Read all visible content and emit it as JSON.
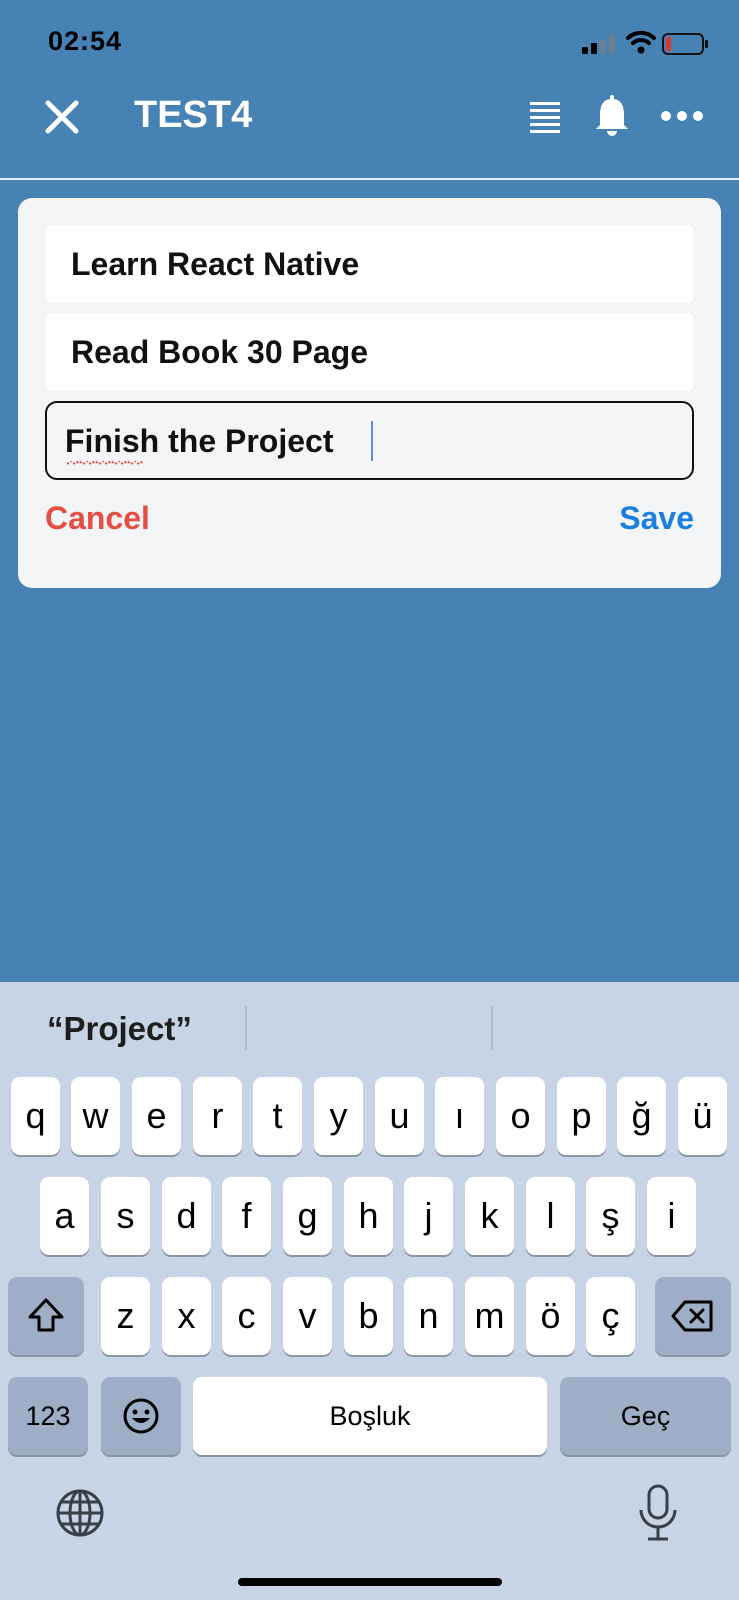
{
  "status_bar": {
    "time": "02:54"
  },
  "header": {
    "title": "TEST4"
  },
  "card": {
    "items": [
      "Learn React Native",
      "Read Book 30 Page"
    ],
    "edit_value": "Finish the Project",
    "cancel_label": "Cancel",
    "save_label": "Save"
  },
  "keyboard": {
    "suggestion": "“Project”",
    "row1": [
      "q",
      "w",
      "e",
      "r",
      "t",
      "y",
      "u",
      "ı",
      "o",
      "p",
      "ğ",
      "ü"
    ],
    "row2": [
      "a",
      "s",
      "d",
      "f",
      "g",
      "h",
      "j",
      "k",
      "l",
      "ş",
      "i"
    ],
    "row3": [
      "z",
      "x",
      "c",
      "v",
      "b",
      "n",
      "m",
      "ö",
      "ç"
    ],
    "numbers_label": "123",
    "space_label": "Boşluk",
    "return_label": "Geç"
  },
  "colors": {
    "background": "#4682b4",
    "cancel": "#e54e43",
    "save": "#1a7fe0"
  }
}
